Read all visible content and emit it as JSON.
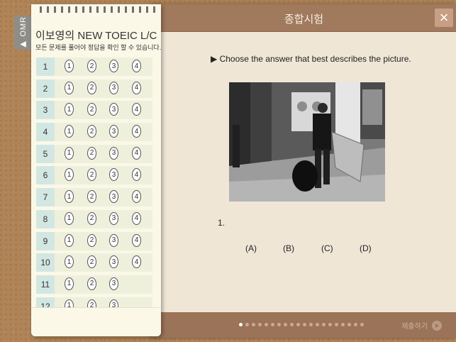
{
  "exam": {
    "title": "종합시험",
    "close_icon": "×",
    "instruction": "▶ Choose the answer that best describes the picture.",
    "question_number": "1.",
    "choices": [
      "(A)",
      "(B)",
      "(C)",
      "(D)"
    ],
    "submit_label": "제출하기",
    "page_dots_total": 20,
    "page_dots_active": 0
  },
  "omr": {
    "tab_label": "▶ OMR",
    "title": "이보영의 NEW TOEIC L/C",
    "subtitle": "모든 문제를 풀어야 정답을 확인 할 수 있습니다.",
    "rows": [
      {
        "num": "1",
        "options": [
          "1",
          "2",
          "3",
          "4"
        ]
      },
      {
        "num": "2",
        "options": [
          "1",
          "2",
          "3",
          "4"
        ]
      },
      {
        "num": "3",
        "options": [
          "1",
          "2",
          "3",
          "4"
        ]
      },
      {
        "num": "4",
        "options": [
          "1",
          "2",
          "3",
          "4"
        ]
      },
      {
        "num": "5",
        "options": [
          "1",
          "2",
          "3",
          "4"
        ]
      },
      {
        "num": "6",
        "options": [
          "1",
          "2",
          "3",
          "4"
        ]
      },
      {
        "num": "7",
        "options": [
          "1",
          "2",
          "3",
          "4"
        ]
      },
      {
        "num": "8",
        "options": [
          "1",
          "2",
          "3",
          "4"
        ]
      },
      {
        "num": "9",
        "options": [
          "1",
          "2",
          "3",
          "4"
        ]
      },
      {
        "num": "10",
        "options": [
          "1",
          "2",
          "3",
          "4"
        ]
      },
      {
        "num": "11",
        "options": [
          "1",
          "2",
          "3"
        ]
      },
      {
        "num": "12",
        "options": [
          "1",
          "2",
          "3"
        ]
      }
    ]
  },
  "colors": {
    "header": "#a1795c",
    "panel": "#efe6d6",
    "omr_bg": "#fbf8e8",
    "row_num_bg": "#d3e7e2"
  }
}
